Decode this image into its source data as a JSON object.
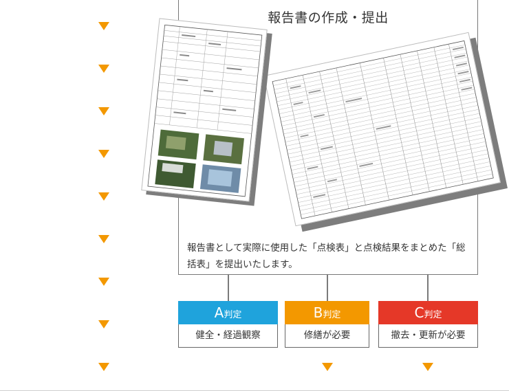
{
  "title": "報告書の作成・提出",
  "description": "報告書として実際に使用した「点検表」と点検結果をまとめた「総括表」を提出いたします。",
  "judgements": [
    {
      "grade": "A",
      "suffix": "判定",
      "label": "健全・経過観察",
      "color": "#1fa3dc"
    },
    {
      "grade": "B",
      "suffix": "判定",
      "label": "修繕が必要",
      "color": "#f39800"
    },
    {
      "grade": "C",
      "suffix": "判定",
      "label": "撤去・更新が必要",
      "color": "#e53828"
    }
  ],
  "colors": {
    "arrow": "#f39800",
    "connector": "#7a7a7a"
  }
}
